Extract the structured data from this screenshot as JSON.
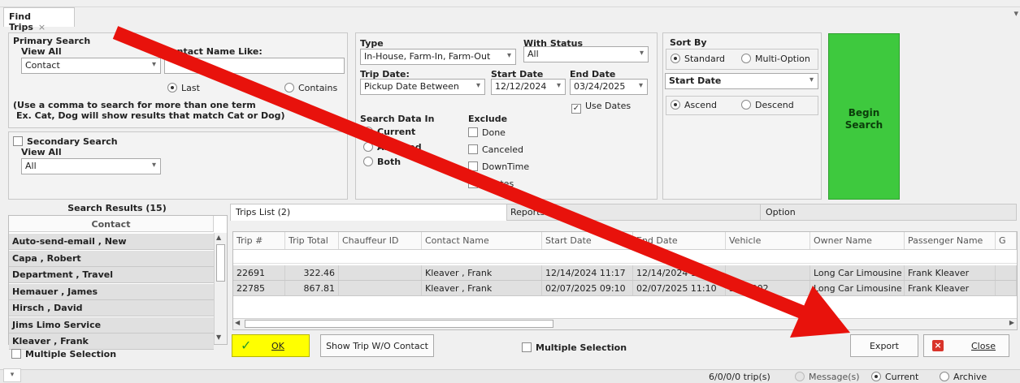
{
  "window": {
    "tab_title": "Find Trips",
    "close_tab": "×",
    "overflow": "▾"
  },
  "primary": {
    "title": "Primary Search",
    "view_all": "View All",
    "view_value": "Contact",
    "name_like_label": "Contact Name Like:",
    "radio_last": "Last",
    "radio_contains": "Contains",
    "help1": "(Use a comma to search for more than one term",
    "help2": "Ex. Cat, Dog will show results that match Cat or Dog)"
  },
  "secondary": {
    "title": "Secondary Search",
    "view_all": "View All",
    "value": "All"
  },
  "filters": {
    "type_label": "Type",
    "type_value": "In-House, Farm-In, Farm-Out",
    "status_label": "With Status",
    "status_value": "All",
    "trip_date_label": "Trip Date:",
    "trip_date_value": "Pickup Date Between",
    "start_label": "Start Date",
    "start_value": "12/12/2024",
    "end_label": "End Date",
    "end_value": "03/24/2025",
    "use_dates": "Use Dates",
    "search_in_label": "Search Data In",
    "current": "Current",
    "archived": "Archived",
    "both": "Both",
    "exclude_label": "Exclude",
    "ex_done": "Done",
    "ex_canceled": "Canceled",
    "ex_downtime": "DownTime",
    "ex_quotes": "Quotes"
  },
  "sort": {
    "label": "Sort By",
    "standard": "Standard",
    "multi": "Multi-Option",
    "field": "Start Date",
    "ascend": "Ascend",
    "descend": "Descend"
  },
  "begin_search": {
    "line1": "Begin",
    "line2": "Search"
  },
  "results": {
    "title": "Search Results (15)",
    "column": "Contact",
    "items": [
      "Auto-send-email , New",
      "Capa , Robert",
      "Department , Travel",
      "Hemauer , James",
      "Hirsch , David",
      "Jims Limo Service",
      "Kleaver , Frank"
    ],
    "multiple_selection": "Multiple Selection"
  },
  "trips": {
    "tab_list": "Trips List (2)",
    "tab_reports": "Reports",
    "tab_option": "Option",
    "columns": [
      "Trip #",
      "Trip Total",
      "Chauffeur ID",
      "Contact Name",
      "Start Date",
      "End Date",
      "Vehicle",
      "Owner Name",
      "Passenger Name",
      "G"
    ],
    "rows": [
      [
        "22691",
        "322.46",
        "",
        "Kleaver , Frank",
        "12/14/2024 11:17",
        "12/14/2024 11:17",
        "",
        "Long Car Limousine C...",
        "Frank Kleaver",
        ""
      ],
      [
        "22785",
        "867.81",
        "",
        "Kleaver , Frank",
        "02/07/2025 09:10",
        "02/07/2025 11:10",
        "SDN-002",
        "Long Car Limousine C...",
        "Frank Kleaver",
        ""
      ]
    ]
  },
  "buttons": {
    "ok": "OK",
    "show_trip": "Show Trip W/O Contact",
    "multiple_selection": "Multiple Selection",
    "export": "Export",
    "close": "Close"
  },
  "status": {
    "trips": "6/0/0/0 trip(s)",
    "messages": "Message(s)",
    "current": "Current",
    "archive": "Archive"
  },
  "colors": {
    "accent_green": "#3ec93e",
    "ok_yellow": "#ffff00",
    "arrow_red": "#e8120c",
    "close_red": "#d9342b"
  }
}
